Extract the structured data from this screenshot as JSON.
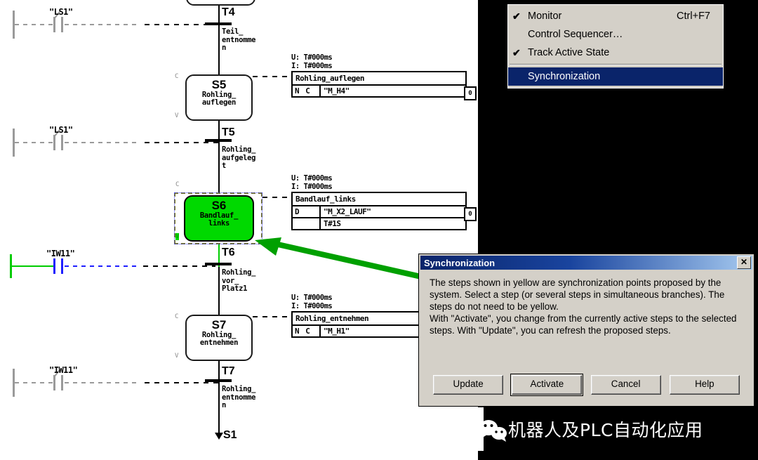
{
  "editor": {
    "steps": [
      {
        "id": "S5",
        "name_line1": "Rohling_",
        "name_line2": "auflegen",
        "active": false
      },
      {
        "id": "S6",
        "name_line1": "Bandlauf_",
        "name_line2": "links",
        "active": true
      },
      {
        "id": "S7",
        "name_line1": "Rohling_",
        "name_line2": "entnehmen",
        "active": false
      }
    ],
    "transitions": [
      {
        "id": "T4",
        "name_line1": "Teil_",
        "name_line2": "entnomme",
        "name_line3": "n",
        "operand": "\"LS1\"",
        "active": false
      },
      {
        "id": "T5",
        "name_line1": "Rohling_",
        "name_line2": "aufgeleg",
        "name_line3": "t",
        "operand": "\"LS1\"",
        "active": false
      },
      {
        "id": "T6",
        "name_line1": "Rohling_",
        "name_line2": "vor_",
        "name_line3": "Platz1",
        "operand": "\"IW11\"",
        "active": true
      },
      {
        "id": "T7",
        "name_line1": "Rohling_",
        "name_line2": "entnomme",
        "name_line3": "n",
        "operand": "\"IW11\"",
        "active": false
      }
    ],
    "jump_target": "S1",
    "step_corner_top": "C",
    "step_corner_bottom": "V",
    "action_blocks": [
      {
        "time_u": "U: T#000ms",
        "time_i": "I: T#000ms",
        "header": "Rohling_auflegen",
        "rows": [
          {
            "qualifier": "N C",
            "value": "\"M_H4\""
          }
        ],
        "state_chip": "0"
      },
      {
        "time_u": "U: T#000ms",
        "time_i": "I: T#000ms",
        "header": "Bandlauf_links",
        "rows": [
          {
            "qualifier": "D",
            "value": "\"M_X2_LAUF\""
          },
          {
            "qualifier": "",
            "value": "T#1S"
          }
        ],
        "state_chip": "0"
      },
      {
        "time_u": "U: T#000ms",
        "time_i": "I: T#000ms",
        "header": "Rohling_entnehmen",
        "rows": [
          {
            "qualifier": "N C",
            "value": "\"M_H1\""
          }
        ],
        "state_chip": ""
      }
    ],
    "colors": {
      "active_step_fill": "#00d900",
      "active_power_rail": "#00cc00",
      "active_contact": "#2020ff",
      "selection_border": "#7a7a20",
      "annotation_arrow": "#00a000"
    }
  },
  "menu": {
    "items": [
      {
        "check": "✔",
        "label": "Monitor",
        "accel": "Ctrl+F7",
        "selected": false
      },
      {
        "check": "",
        "label": "Control Sequencer…",
        "accel": "",
        "selected": false
      },
      {
        "check": "✔",
        "label": "Track Active State",
        "accel": "",
        "selected": false
      },
      {
        "separator": true
      },
      {
        "check": "",
        "label": "Synchronization",
        "accel": "",
        "selected": true
      }
    ]
  },
  "dialog": {
    "title": "Synchronization",
    "close_label": "✕",
    "body": "The steps shown in yellow are synchronization points proposed by the system. Select a step (or several steps in simultaneous branches). The steps do not need to be yellow.\nWith \"Activate\", you change from the currently active steps to the selected steps. With \"Update\", you can refresh the proposed steps.",
    "buttons": [
      {
        "label": "Update",
        "default": false
      },
      {
        "label": "Activate",
        "default": true
      },
      {
        "label": "Cancel",
        "default": false
      },
      {
        "label": "Help",
        "default": false
      }
    ]
  },
  "watermark": {
    "text": "机器人及PLC自动化应用"
  }
}
